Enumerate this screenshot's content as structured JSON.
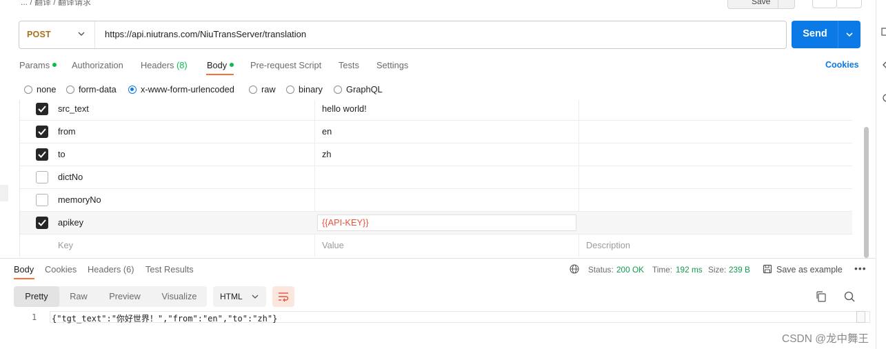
{
  "header": {
    "breadcrumb": "... / 翻译 / 翻译请求",
    "save_label": "Save"
  },
  "request": {
    "method": "POST",
    "url": "https://api.niutrans.com/NiuTransServer/translation",
    "send_label": "Send"
  },
  "request_tabs": {
    "params": "Params",
    "authorization": "Authorization",
    "headers": "Headers",
    "headers_count": "(8)",
    "body": "Body",
    "pre_request": "Pre-request Script",
    "tests": "Tests",
    "settings": "Settings",
    "cookies": "Cookies",
    "active": "Body"
  },
  "body_types": {
    "none": "none",
    "form_data": "form-data",
    "urlencoded": "x-www-form-urlencoded",
    "raw": "raw",
    "binary": "binary",
    "graphql": "GraphQL",
    "selected": "x-www-form-urlencoded"
  },
  "params": [
    {
      "checked": true,
      "key": "src_text",
      "value": "hello world!"
    },
    {
      "checked": true,
      "key": "from",
      "value": "en"
    },
    {
      "checked": true,
      "key": "to",
      "value": "zh"
    },
    {
      "checked": false,
      "key": "dictNo",
      "value": ""
    },
    {
      "checked": false,
      "key": "memoryNo",
      "value": ""
    },
    {
      "checked": true,
      "key": "apikey",
      "value": "{{API-KEY}}"
    }
  ],
  "params_placeholder": {
    "key": "Key",
    "value": "Value",
    "description": "Description"
  },
  "response_tabs": {
    "body": "Body",
    "cookies": "Cookies",
    "headers": "Headers (6)",
    "test_results": "Test Results"
  },
  "response_status": {
    "status_label": "Status:",
    "status_value": "200 OK",
    "time_label": "Time:",
    "time_value": "192 ms",
    "size_label": "Size:",
    "size_value": "239 B",
    "save_example": "Save as example"
  },
  "response_view": {
    "pretty": "Pretty",
    "raw": "Raw",
    "preview": "Preview",
    "visualize": "Visualize",
    "format": "HTML"
  },
  "response_body": {
    "line_number": "1",
    "content": "{\"tgt_text\":\"你好世界！\",\"from\":\"en\",\"to\":\"zh\"}"
  },
  "watermark": "CSDN @龙中舞王",
  "colors": {
    "accent": "#0c7ae6",
    "method": "#a8701a",
    "active_tab": "#ff6c37",
    "status_ok": "#0f9d4b",
    "variable": "#e5533d"
  }
}
